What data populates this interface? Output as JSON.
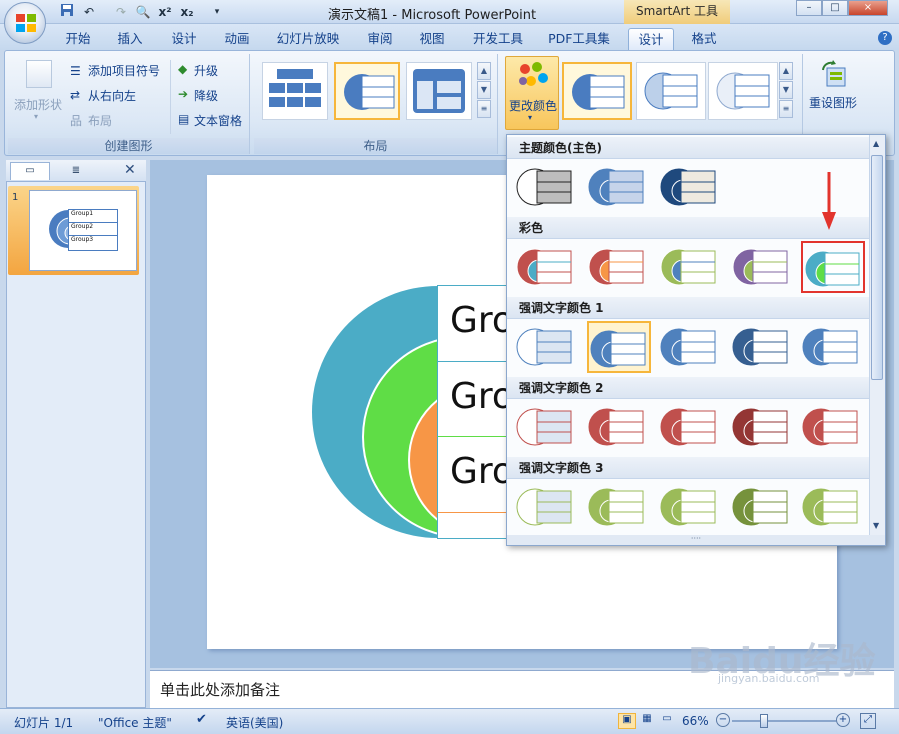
{
  "window": {
    "title": "演示文稿1 - Microsoft PowerPoint",
    "contextual_tab_group": "SmartArt 工具",
    "minimize": "–",
    "maximize": "□",
    "close": "×"
  },
  "tabs": [
    "开始",
    "插入",
    "设计",
    "动画",
    "幻灯片放映",
    "审阅",
    "视图",
    "开发工具",
    "PDF工具集",
    "设计",
    "格式"
  ],
  "ribbon": {
    "create_graphic": {
      "label": "创建图形",
      "add_shape": "添加形状",
      "add_bullet": "添加项目符号",
      "right_to_left": "从右向左",
      "layout": "布局",
      "promote": "升级",
      "demote": "降级",
      "text_pane": "文本窗格"
    },
    "layouts": {
      "label": "布局"
    },
    "styles": {
      "change_colors": "更改颜色",
      "reset": "重设图形"
    }
  },
  "thumbnail": {
    "number": "1",
    "items": [
      "Group1",
      "Group2",
      "Group3"
    ]
  },
  "slide": {
    "items": [
      "Gro",
      "Gro",
      "Gro"
    ]
  },
  "notes": {
    "placeholder": "单击此处添加备注"
  },
  "statusbar": {
    "slide": "幻灯片 1/1",
    "theme": "\"Office 主题\"",
    "language": "英语(美国)",
    "zoom": "66%"
  },
  "dropdown": {
    "sections": [
      {
        "title": "主题颜色(主色)",
        "colors": [
          "#404040",
          "#4f81bd",
          "#1f497d"
        ]
      },
      {
        "title": "彩色",
        "colors": [
          "#c0504d",
          "#c0504d",
          "#9bbb59",
          "#8064a2",
          "#4bacc6"
        ]
      },
      {
        "title": "强调文字颜色 1",
        "colors": [
          "#4f81bd",
          "#4f81bd",
          "#4f81bd",
          "#365f91",
          "#4f81bd"
        ]
      },
      {
        "title": "强调文字颜色 2",
        "colors": [
          "#c0504d",
          "#c0504d",
          "#c0504d",
          "#943634",
          "#c0504d"
        ]
      },
      {
        "title": "强调文字颜色 3",
        "colors": [
          "#9bbb59",
          "#9bbb59",
          "#9bbb59",
          "#76923c",
          "#9bbb59"
        ]
      }
    ]
  },
  "watermark": {
    "main": "Baidu经验",
    "sub": "jingyan.baidu.com"
  }
}
